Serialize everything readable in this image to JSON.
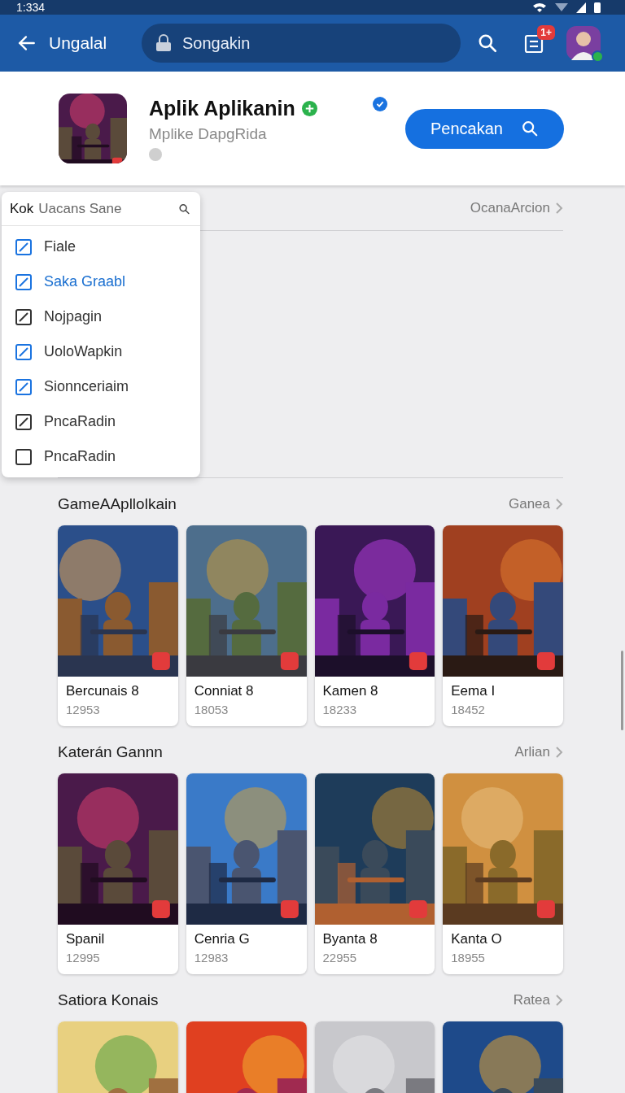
{
  "status_bar": {
    "time": "1:334"
  },
  "header": {
    "title": "Ungalal",
    "search": {
      "value": "Songakin"
    },
    "notification_badge": "1+"
  },
  "app": {
    "name": "Aplik Aplikanin",
    "subtitle": "Mplike DapgRida",
    "verified": true,
    "install_button": "Pencakan"
  },
  "filter": {
    "link": "OcanaArcion",
    "dropdown": {
      "label": "Kok",
      "placeholder": "Uacans Sane",
      "options": [
        {
          "label": "Fiale",
          "checked": true,
          "color": "#1a73e0",
          "selected": false
        },
        {
          "label": "Saka Graabl",
          "checked": true,
          "color": "#1a73e0",
          "selected": true
        },
        {
          "label": "Nojpagin",
          "checked": true,
          "color": "#333333",
          "selected": false
        },
        {
          "label": "UoloWapkin",
          "checked": true,
          "color": "#1a73e0",
          "selected": false
        },
        {
          "label": "Sionnceriaim",
          "checked": true,
          "color": "#1a73e0",
          "selected": false
        },
        {
          "label": "PncaRadin",
          "checked": true,
          "color": "#333333",
          "selected": false
        },
        {
          "label": "PncaRadin",
          "checked": false,
          "color": "#333333",
          "selected": false
        }
      ]
    }
  },
  "sections": [
    {
      "title": "GameAApllolkain",
      "link": "Ganea",
      "cards": [
        {
          "kind": "game",
          "name": "Bercunais 8",
          "count": "12953"
        },
        {
          "kind": "game",
          "name": "Conniat 8",
          "count": "18053"
        },
        {
          "kind": "game",
          "name": "Kamen 8",
          "count": "18233"
        },
        {
          "kind": "game",
          "name": "Eema I",
          "count": "18452"
        }
      ]
    },
    {
      "title": "Katerán Gannn",
      "link": "Arlian",
      "cards": [
        {
          "kind": "game",
          "name": "Spanil",
          "count": "12995"
        },
        {
          "kind": "game",
          "name": "Cenria G",
          "count": "12983"
        },
        {
          "kind": "game",
          "name": "Byanta 8",
          "count": "22955"
        },
        {
          "kind": "game",
          "name": "Kanta O",
          "count": "18955"
        }
      ]
    },
    {
      "title": "Satiora Konais",
      "link": "Ratea"
    }
  ]
}
